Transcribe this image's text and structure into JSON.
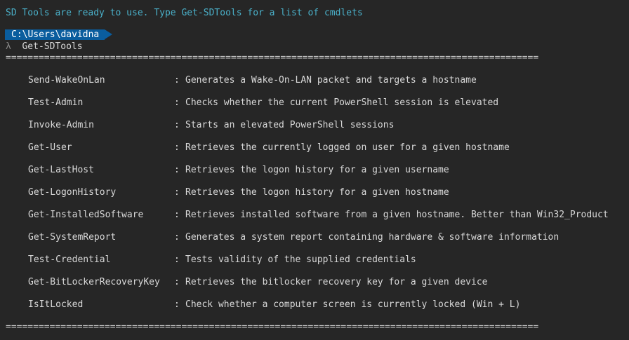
{
  "banner": "SD Tools are ready to use. Type Get-SDTools for a list of cmdlets",
  "prompt": {
    "path": "C:\\Users\\davidna",
    "symbol": "λ",
    "command": "Get-SDTools"
  },
  "separator": "==================================================================================================",
  "colon": ":",
  "cmdlets": [
    {
      "name": "Send-WakeOnLan",
      "desc": "Generates a Wake-On-LAN packet and targets a hostname"
    },
    {
      "name": "Test-Admin",
      "desc": "Checks whether the current PowerShell session is elevated"
    },
    {
      "name": "Invoke-Admin",
      "desc": "Starts an elevated PowerShell sessions"
    },
    {
      "name": "Get-User",
      "desc": "Retrieves the currently logged on user for a given hostname"
    },
    {
      "name": "Get-LastHost",
      "desc": "Retrieves the logon history for a given username"
    },
    {
      "name": "Get-LogonHistory",
      "desc": "Retrieves the logon history for a given hostname"
    },
    {
      "name": "Get-InstalledSoftware",
      "desc": "Retrieves installed software from a given hostname. Better than Win32_Product"
    },
    {
      "name": "Get-SystemReport",
      "desc": "Generates a system report containing hardware & software information"
    },
    {
      "name": "Test-Credential",
      "desc": "Tests validity of the supplied credentials"
    },
    {
      "name": "Get-BitLockerRecoveryKey",
      "desc": "Retrieves the bitlocker recovery key for a given device"
    },
    {
      "name": "IsItLocked",
      "desc": "Check whether a computer screen is currently locked (Win + L)"
    }
  ],
  "colors": {
    "background": "#262626",
    "banner_text": "#4ab0c9",
    "prompt_segment": "#0a5d9e"
  }
}
